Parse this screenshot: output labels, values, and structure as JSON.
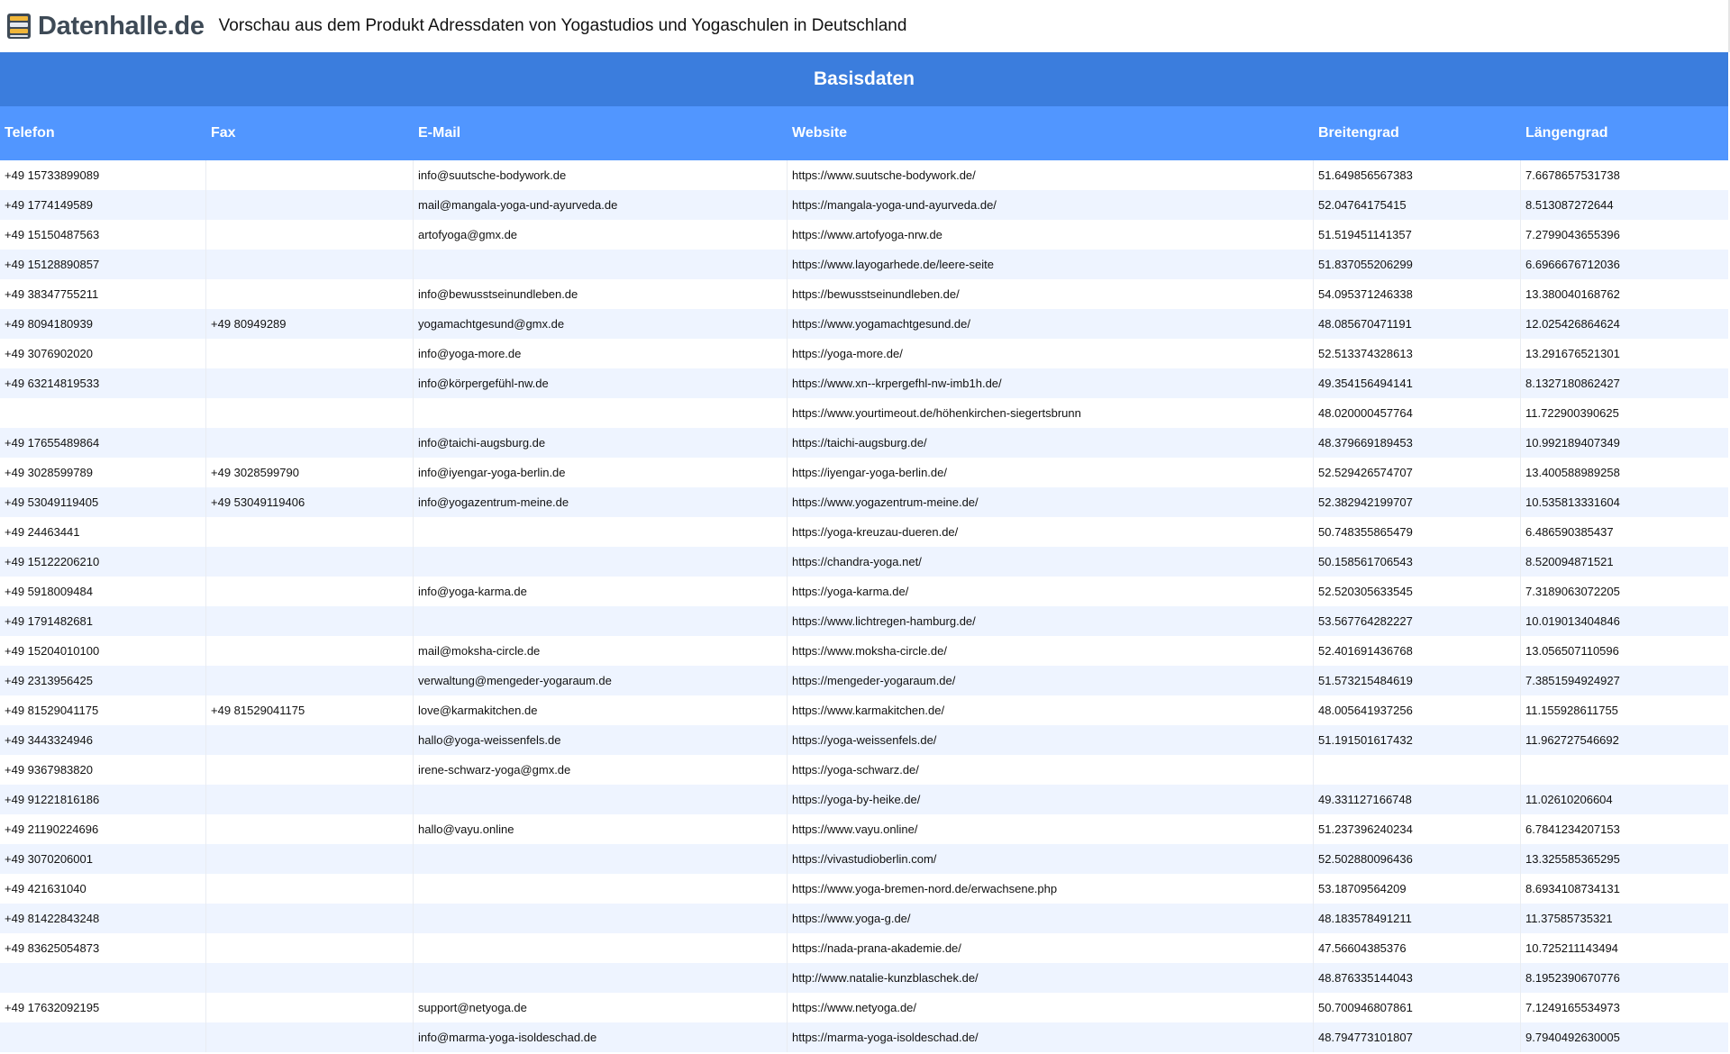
{
  "header": {
    "logo_text": "Datenhalle.de",
    "title": "Vorschau aus dem Produkt Adressdaten von Yogastudios und Yogaschulen in Deutschland"
  },
  "table": {
    "group_label": "Basisdaten",
    "columns": [
      "Telefon",
      "Fax",
      "E-Mail",
      "Website",
      "Breitengrad",
      "Längengrad"
    ],
    "rows": [
      [
        "+49 15733899089",
        "",
        "info@suutsche-bodywork.de",
        "https://www.suutsche-bodywork.de/",
        "51.649856567383",
        "7.6678657531738"
      ],
      [
        "+49 1774149589",
        "",
        "mail@mangala-yoga-und-ayurveda.de",
        "https://mangala-yoga-und-ayurveda.de/",
        "52.04764175415",
        "8.513087272644"
      ],
      [
        "+49 15150487563",
        "",
        "artofyoga@gmx.de",
        "https://www.artofyoga-nrw.de",
        "51.519451141357",
        "7.2799043655396"
      ],
      [
        "+49 15128890857",
        "",
        "",
        "https://www.layogarhede.de/leere-seite",
        "51.837055206299",
        "6.6966676712036"
      ],
      [
        "+49 38347755211",
        "",
        "info@bewusstseinundleben.de",
        "https://bewusstseinundleben.de/",
        "54.095371246338",
        "13.380040168762"
      ],
      [
        "+49 8094180939",
        "+49 80949289",
        "yogamachtgesund@gmx.de",
        "https://www.yogamachtgesund.de/",
        "48.085670471191",
        "12.025426864624"
      ],
      [
        "+49 3076902020",
        "",
        "info@yoga-more.de",
        "https://yoga-more.de/",
        "52.513374328613",
        "13.291676521301"
      ],
      [
        "+49 63214819533",
        "",
        "info@körpergefühl-nw.de",
        "https://www.xn--krpergefhl-nw-imb1h.de/",
        "49.354156494141",
        "8.1327180862427"
      ],
      [
        "",
        "",
        "",
        "https://www.yourtimeout.de/höhenkirchen-siegertsbrunn",
        "48.020000457764",
        "11.722900390625"
      ],
      [
        "+49 17655489864",
        "",
        "info@taichi-augsburg.de",
        "https://taichi-augsburg.de/",
        "48.379669189453",
        "10.992189407349"
      ],
      [
        "+49 3028599789",
        "+49 3028599790",
        "info@iyengar-yoga-berlin.de",
        "https://iyengar-yoga-berlin.de/",
        "52.529426574707",
        "13.400588989258"
      ],
      [
        "+49 53049119405",
        "+49 53049119406",
        "info@yogazentrum-meine.de",
        "https://www.yogazentrum-meine.de/",
        "52.382942199707",
        "10.535813331604"
      ],
      [
        "+49 24463441",
        "",
        "",
        "https://yoga-kreuzau-dueren.de/",
        "50.748355865479",
        "6.486590385437"
      ],
      [
        "+49 15122206210",
        "",
        "",
        "https://chandra-yoga.net/",
        "50.158561706543",
        "8.520094871521"
      ],
      [
        "+49 5918009484",
        "",
        "info@yoga-karma.de",
        "https://yoga-karma.de/",
        "52.520305633545",
        "7.3189063072205"
      ],
      [
        "+49 1791482681",
        "",
        "",
        "https://www.lichtregen-hamburg.de/",
        "53.567764282227",
        "10.019013404846"
      ],
      [
        "+49 15204010100",
        "",
        "mail@moksha-circle.de",
        "https://www.moksha-circle.de/",
        "52.401691436768",
        "13.056507110596"
      ],
      [
        "+49 2313956425",
        "",
        "verwaltung@mengeder-yogaraum.de",
        "https://mengeder-yogaraum.de/",
        "51.573215484619",
        "7.3851594924927"
      ],
      [
        "+49 81529041175",
        "+49 81529041175",
        "love@karmakitchen.de",
        "https://www.karmakitchen.de/",
        "48.005641937256",
        "11.155928611755"
      ],
      [
        "+49 3443324946",
        "",
        "hallo@yoga-weissenfels.de",
        "https://yoga-weissenfels.de/",
        "51.191501617432",
        "11.962727546692"
      ],
      [
        "+49 9367983820",
        "",
        "irene-schwarz-yoga@gmx.de",
        "https://yoga-schwarz.de/",
        "",
        ""
      ],
      [
        "+49 91221816186",
        "",
        "",
        "https://yoga-by-heike.de/",
        "49.331127166748",
        "11.02610206604"
      ],
      [
        "+49 21190224696",
        "",
        "hallo@vayu.online",
        "https://www.vayu.online/",
        "51.237396240234",
        "6.7841234207153"
      ],
      [
        "+49 3070206001",
        "",
        "",
        "https://vivastudioberlin.com/",
        "52.502880096436",
        "13.325585365295"
      ],
      [
        "+49 421631040",
        "",
        "",
        "https://www.yoga-bremen-nord.de/erwachsene.php",
        "53.18709564209",
        "8.6934108734131"
      ],
      [
        "+49 81422843248",
        "",
        "",
        "https://www.yoga-g.de/",
        "48.183578491211",
        "11.37585735321"
      ],
      [
        "+49 83625054873",
        "",
        "",
        "https://nada-prana-akademie.de/",
        "47.56604385376",
        "10.725211143494"
      ],
      [
        "",
        "",
        "",
        "http://www.natalie-kunzblaschek.de/",
        "48.876335144043",
        "8.1952390670776"
      ],
      [
        "+49 17632092195",
        "",
        "support@netyoga.de",
        "https://www.netyoga.de/",
        "50.700946807861",
        "7.1249165534973"
      ],
      [
        "",
        "",
        "info@marma-yoga-isoldeschad.de",
        "https://marma-yoga-isoldeschad.de/",
        "48.794773101807",
        "9.7940492630005"
      ]
    ]
  }
}
